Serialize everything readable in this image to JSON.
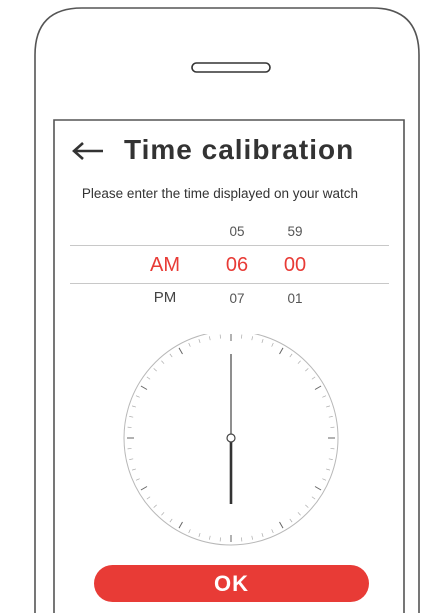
{
  "header": {
    "title": "Time calibration",
    "back_icon": "arrow-left-icon"
  },
  "instruction": "Please enter the time displayed on your watch",
  "picker": {
    "period": {
      "selected": "AM",
      "below": "PM"
    },
    "hour": {
      "above": "05",
      "selected": "06",
      "below": "07"
    },
    "minute": {
      "above": "59",
      "selected": "00",
      "below": "01"
    }
  },
  "clock": {
    "hour": 6,
    "minute": 0
  },
  "ok_button": {
    "label": "OK"
  },
  "colors": {
    "accent": "#e83b36",
    "text": "#333333",
    "divider": "#c8c8c8"
  }
}
